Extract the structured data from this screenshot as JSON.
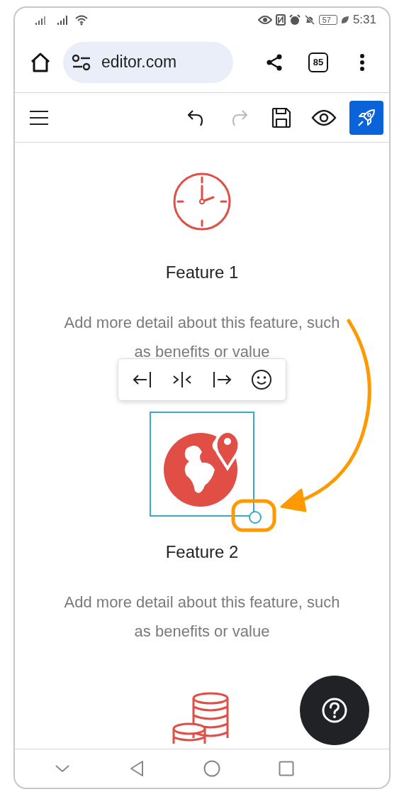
{
  "status_bar": {
    "time": "5:31",
    "battery": "57"
  },
  "browser": {
    "url": "editor.com",
    "tab_count": "85"
  },
  "toolbar": [
    {
      "kind": "undo",
      "disabled": false
    },
    {
      "kind": "redo",
      "disabled": true
    },
    {
      "kind": "save",
      "disabled": false
    },
    {
      "kind": "preview",
      "disabled": false
    },
    {
      "kind": "publish",
      "disabled": false
    }
  ],
  "features": [
    {
      "kind": "clock",
      "title": "Feature 1",
      "description": "Add more detail about this feature, such as benefits or value",
      "selected": false
    },
    {
      "kind": "globe",
      "title": "Feature 2",
      "description": "Add more detail about this feature, such as benefits or value",
      "selected": true
    },
    {
      "kind": "coins",
      "selected": false
    }
  ],
  "align_toolbar": [
    {
      "kind": "align-left"
    },
    {
      "kind": "align-center"
    },
    {
      "kind": "align-right"
    },
    {
      "kind": "emoji"
    }
  ]
}
